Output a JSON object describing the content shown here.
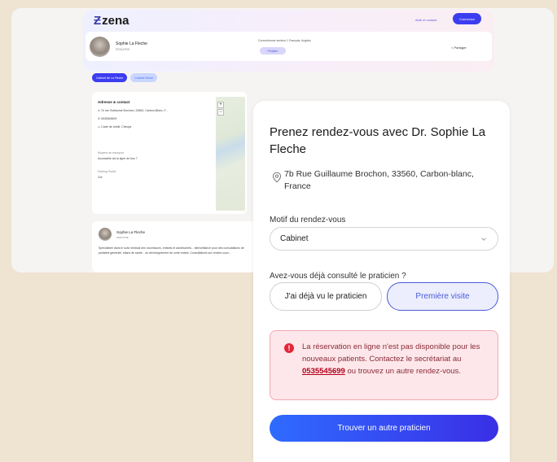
{
  "header": {
    "logo_text": "zena",
    "link_label": "Aide et contact",
    "button_label": "Connexion"
  },
  "doctor": {
    "name": "Sophie La Fleche",
    "specialty": "PEDIATRE",
    "conventions": "Conventionné secteur 1   Français, Anglais",
    "badge": "Pédiatre",
    "share_label": "Partager"
  },
  "tabs": [
    {
      "label": "Cabinet de La Fleche"
    },
    {
      "label": "Cabinet libéral"
    }
  ],
  "info_card": {
    "title": "Adresse & contact",
    "address": "7b rue Guillaume Brochon, 33560, Carbon-Blanc, F...",
    "phone": "0535545699",
    "payment": "Carte de crédit, Chèque",
    "transport_label": "Moyens de transport",
    "transport_value": "Accessible via la ligne de bus 7",
    "parking_label": "Parking Public",
    "parking_value": "Oui"
  },
  "bio": {
    "name": "Sophie La Fleche",
    "specialty": "PEDIATRE",
    "text": "Spécialisée dans le suivi médical des nourrissons, enfants et adolescents... bienveillance pour des consultations de pédiatrie générale, bilans de santé... du développement de votre enfant. Consultations sur rendez-vous..."
  },
  "modal": {
    "title": "Prenez rendez-vous avec Dr. Sophie La Fleche",
    "address": "7b Rue Guillaume Brochon, 33560, Carbon-blanc, France",
    "motif_label": "Motif du rendez-vous",
    "motif_value": "Cabinet",
    "question": "Avez-vous déjà consulté le praticien ?",
    "option_seen": "J'ai déjà vu le praticien",
    "option_first": "Première visite",
    "alert_before": "La réservation en ligne n'est pas disponible pour les nouveaux patients. Contactez le secrétariat au ",
    "alert_phone": "0535545699",
    "alert_after": " ou trouvez un autre rendez-vous.",
    "cta_label": "Trouver un autre praticien"
  },
  "colors": {
    "accent": "#3d3df0",
    "alert_bg": "#fde7ea",
    "alert_icon": "#e3263a",
    "page_bg": "#efe3d2"
  }
}
